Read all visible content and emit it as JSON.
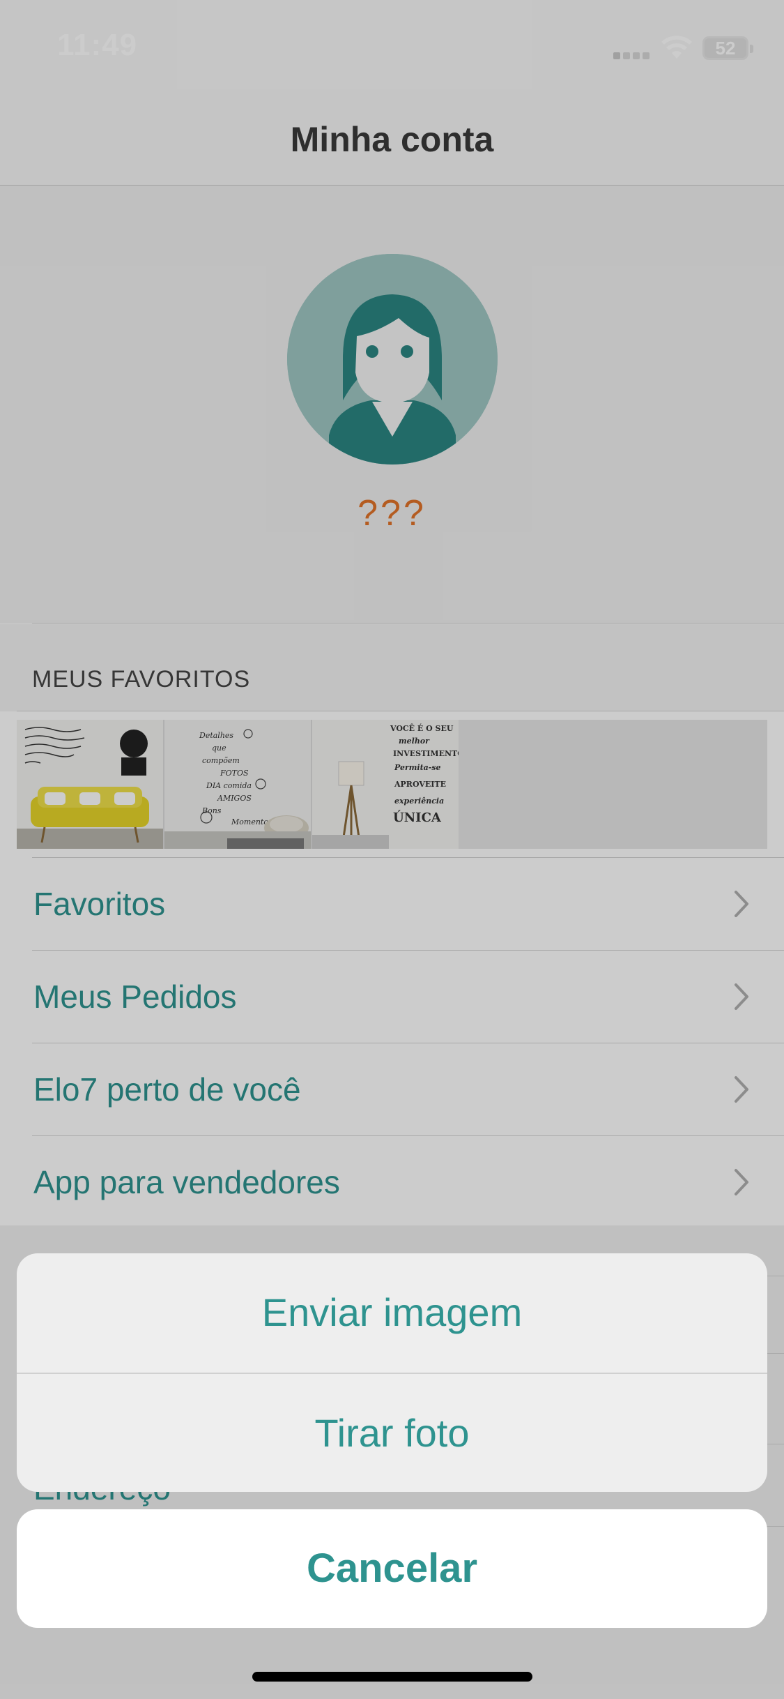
{
  "status_bar": {
    "time": "11:49",
    "battery": "52"
  },
  "nav": {
    "title": "Minha conta"
  },
  "profile": {
    "name": "???"
  },
  "favorites": {
    "header": "MEUS FAVORITOS"
  },
  "menu": {
    "items": [
      {
        "label": "Favoritos"
      },
      {
        "label": "Meus Pedidos"
      },
      {
        "label": "Elo7 perto de você"
      },
      {
        "label": "App para vendedores"
      }
    ],
    "partially_hidden_label": "Endereço"
  },
  "action_sheet": {
    "option1": "Enviar imagem",
    "option2": "Tirar foto",
    "cancel": "Cancelar"
  },
  "colors": {
    "accent": "#2e938f",
    "name": "#e2742a"
  }
}
